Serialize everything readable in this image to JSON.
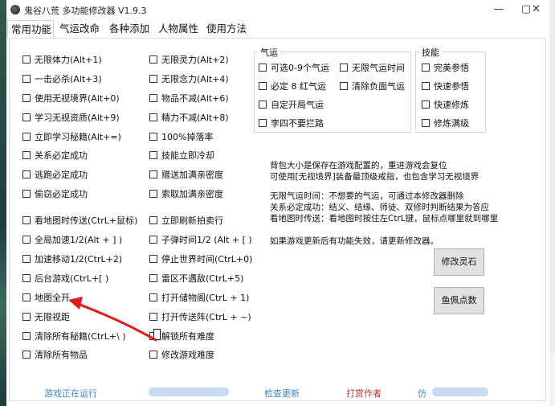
{
  "window": {
    "title": "鬼谷八荒  多功能修改器  V1.9.3",
    "minimize_icon": "minimize-icon",
    "maximize_icon": "maximize-icon",
    "close_icon": "close-icon"
  },
  "tabs": [
    "常用功能",
    "气运改命",
    "各种添加",
    "人物属性",
    "使用方法"
  ],
  "left_col": [
    "无限体力(Alt+1)",
    "一击必杀(Alt+3)",
    "使用无视境界(Alt+0)",
    "学习无视资质(Alt+9)",
    "立即学习秘籍(Alt+=)",
    "关系必定成功",
    "逃跑必定成功",
    "偷窃必定成功",
    "看地图时传送(CtrL+鼠标)",
    "全局加速1/2(Alt + ] )",
    "加速移动1/2(CtrL+2)",
    "后台游戏(CtrL+[ )",
    "地图全开",
    "无限视距",
    "清除所有秘籍(CtrL+\\ )",
    "清除所有物品"
  ],
  "mid_col": [
    "无限灵力(Alt+2)",
    "无限念力(Alt+4)",
    "物品不减(Alt+6)",
    "精力不减(Alt+8)",
    "100%掉落率",
    "技能立即冷却",
    "赠送加满亲密度",
    "索取加满亲密度",
    "立即刷新拍卖行",
    "子弹时间1/2 (Alt + [ )",
    "停止世界时间(CtrL+0)",
    "雷区不遇敌(CtrL+5)",
    "打开储物阁(CtrL + 1)",
    "打开传送阵(CtrL + ~)",
    "解锁所有难度",
    "修改游戏难度"
  ],
  "qiyun": {
    "title": "气运",
    "items": [
      "可选0-9个气运",
      "无限气运时间",
      "必定 8 红气运",
      "清除负面气运",
      "自定开局气运",
      "李四不要拦路"
    ]
  },
  "jineng": {
    "title": "技能",
    "items": [
      "完美参悟",
      "快速参悟",
      "快速修炼",
      "修炼满级"
    ]
  },
  "info_lines": [
    "背包大小是保存在游戏配置的，重进游戏会复位",
    "可使用[无视境界]装备最顶级戒指，也包含学习无视境界",
    "无限气运时间：不想要的气运，可通过本修改器删除",
    "关系必定成功：结义、结缘、师徒、双修时判断结果为答应",
    "看地图时传送：看地图时按住左CtrL键，鼠标点哪里就到哪里",
    "如果游戏更新后有功能失效，请更新修改器。"
  ],
  "buttons": {
    "lingshi": "修改灵石",
    "yupei": "鱼佩点数"
  },
  "footer": {
    "status": "游戏正在运行",
    "check_update": "检查更新",
    "donate": "打赏作者",
    "partial": "仿",
    "status_color": "#3a86c8",
    "donate_color": "#d22b2b"
  },
  "annotation": {
    "color": "#e01b1b"
  }
}
